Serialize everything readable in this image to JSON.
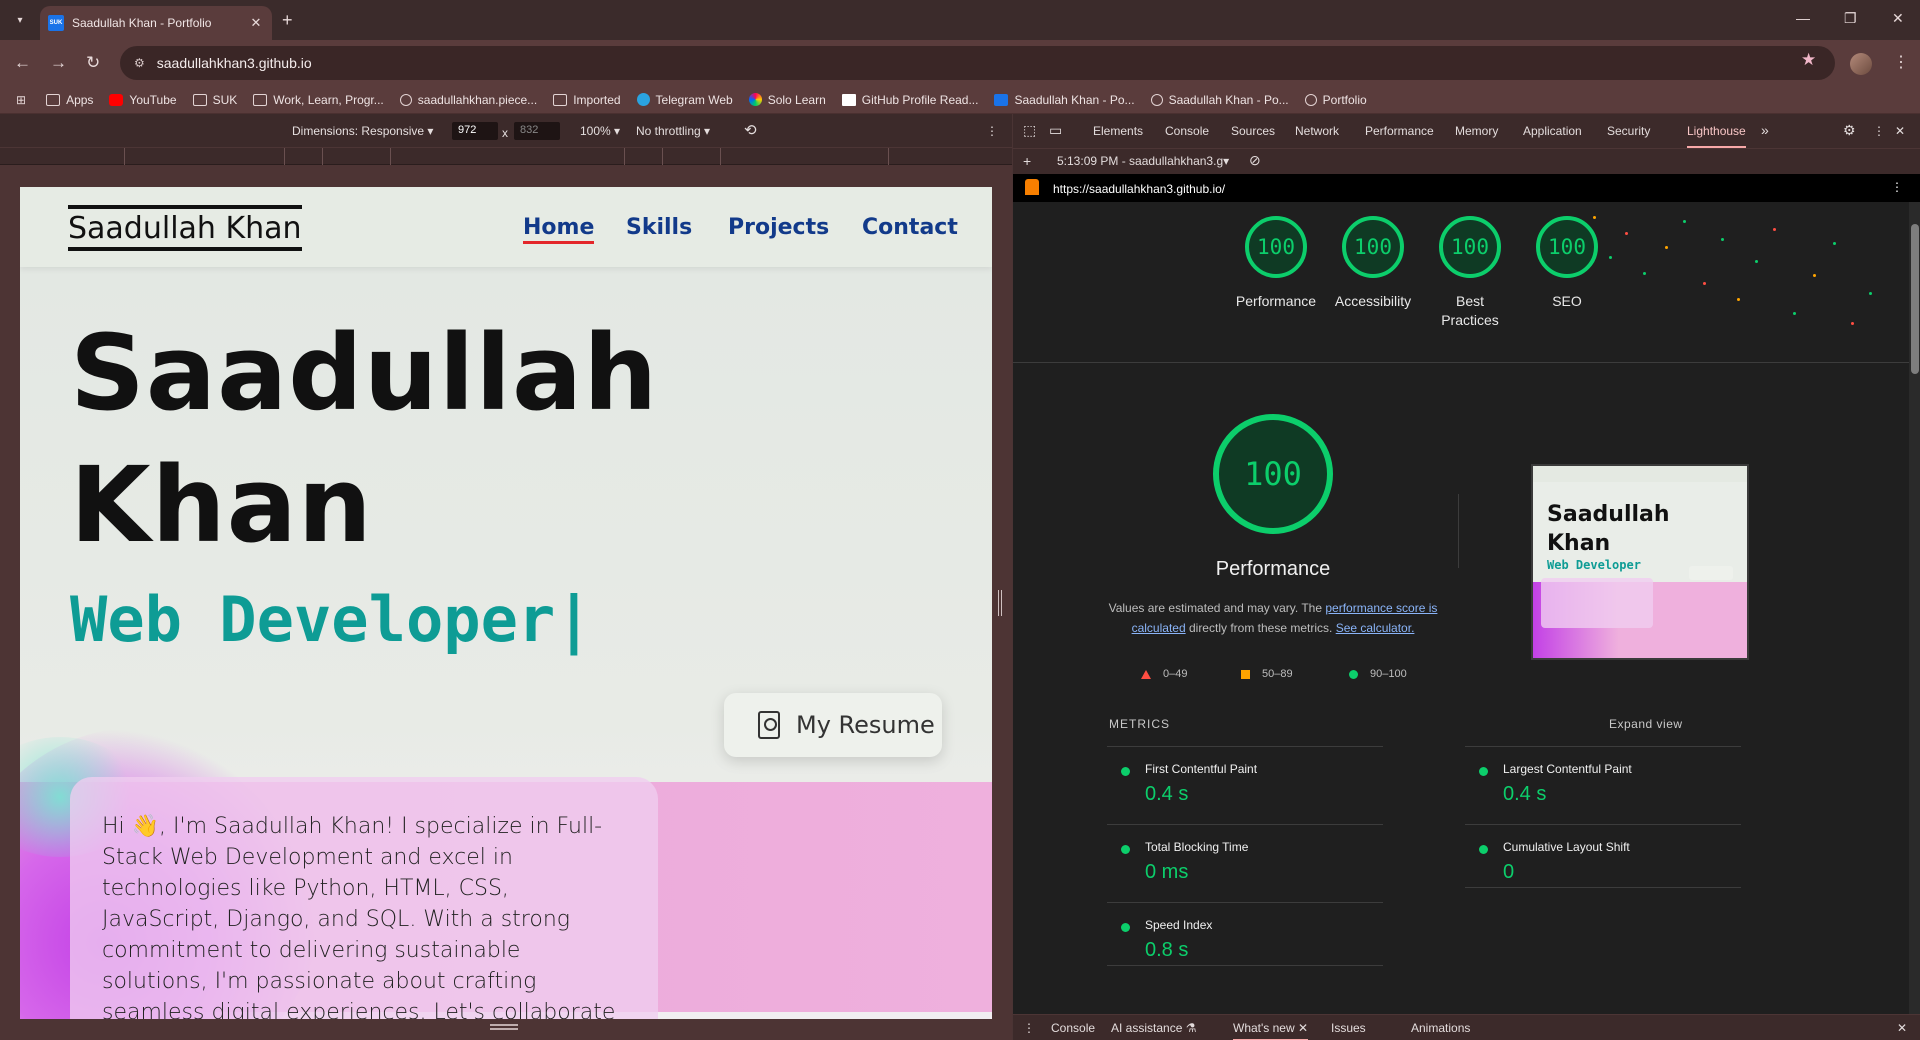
{
  "browser": {
    "tab_title": "Saadullah Khan - Portfolio",
    "favicon_text": "SUK",
    "url": "saadullahkhan3.github.io",
    "bookmarks": [
      {
        "label": "Apps",
        "icon": "folder-icon"
      },
      {
        "label": "YouTube",
        "icon": "youtube-icon"
      },
      {
        "label": "SUK",
        "icon": "folder-icon"
      },
      {
        "label": "Work, Learn, Progr...",
        "icon": "folder-icon"
      },
      {
        "label": "saadullahkhan.piece...",
        "icon": "globe-icon"
      },
      {
        "label": "Imported",
        "icon": "folder-icon"
      },
      {
        "label": "Telegram Web",
        "icon": "telegram-icon"
      },
      {
        "label": "Solo Learn",
        "icon": "sololearn-icon"
      },
      {
        "label": "GitHub Profile Read...",
        "icon": "ghp-icon"
      },
      {
        "label": "Saadullah Khan - Po...",
        "icon": "suk-icon"
      },
      {
        "label": "Saadullah Khan - Po...",
        "icon": "globe-icon"
      },
      {
        "label": "Portfolio",
        "icon": "globe-icon"
      }
    ]
  },
  "device_toolbar": {
    "dimensions_label": "Dimensions: Responsive",
    "width": "972",
    "times": "x",
    "height": "832",
    "zoom": "100%",
    "throttling": "No throttling"
  },
  "site": {
    "logo": "Saadullah Khan",
    "nav": [
      "Home",
      "Skills",
      "Projects",
      "Contact"
    ],
    "hero_first": "Saadullah",
    "hero_last": "Khan",
    "role": "Web Developer",
    "caret": "|",
    "resume_label": "My Resume",
    "intro": "Hi 👋, I'm Saadullah Khan! I specialize in Full-Stack Web Development and excel in technologies like Python, HTML, CSS, JavaScript, Django, and SQL. With a strong commitment to delivering sustainable solutions, I'm passionate about crafting seamless digital experiences. Let's collaborate and turn your vision into reality!"
  },
  "devtools": {
    "tabs": [
      "Elements",
      "Console",
      "Sources",
      "Network",
      "Performance",
      "Memory",
      "Application",
      "Security",
      "Lighthouse"
    ],
    "report_selector": "5:13:09 PM - saadullahkhan3.g",
    "report_url": "https://saadullahkhan3.github.io/",
    "scores": [
      {
        "label": "Performance",
        "value": "100"
      },
      {
        "label": "Accessibility",
        "value": "100"
      },
      {
        "label": "Best Practices",
        "value": "100"
      },
      {
        "label": "SEO",
        "value": "100"
      }
    ],
    "main_score": "100",
    "main_title": "Performance",
    "note_prefix": "Values are estimated and may vary. The ",
    "note_link1": "performance score is calculated",
    "note_middle": " directly from these metrics. ",
    "note_link2": "See calculator.",
    "legend": [
      "0–49",
      "50–89",
      "90–100"
    ],
    "metrics_heading": "METRICS",
    "expand_label": "Expand view",
    "metrics": [
      {
        "name": "First Contentful Paint",
        "value": "0.4 s"
      },
      {
        "name": "Largest Contentful Paint",
        "value": "0.4 s"
      },
      {
        "name": "Total Blocking Time",
        "value": "0 ms"
      },
      {
        "name": "Cumulative Layout Shift",
        "value": "0"
      },
      {
        "name": "Speed Index",
        "value": "0.8 s"
      }
    ],
    "drawer_tabs": [
      "Console",
      "AI assistance",
      "What's new",
      "Issues",
      "Animations"
    ],
    "colors": {
      "pass": "#0cce6b",
      "average": "#ffa400",
      "fail": "#ff4e42"
    }
  }
}
